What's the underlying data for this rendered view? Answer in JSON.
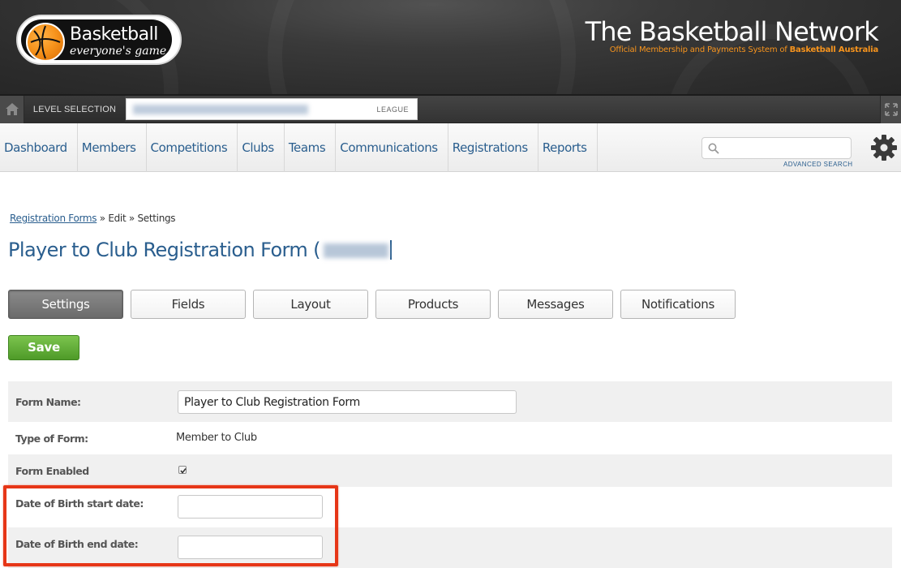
{
  "header": {
    "logo_name": "Basketball",
    "logo_tagline": "everyone's game",
    "brand_title": "The Basketball Network",
    "brand_subtitle_prefix": "Official Membership and Payments System of ",
    "brand_subtitle_bold": "Basketball Australia"
  },
  "levelbar": {
    "label": "LEVEL SELECTION",
    "level_type": "LEAGUE"
  },
  "nav": {
    "items": [
      "Dashboard",
      "Members",
      "Competitions",
      "Clubs",
      "Teams",
      "Communications",
      "Registrations",
      "Reports"
    ],
    "search_placeholder": "",
    "advanced_search": "ADVANCED SEARCH"
  },
  "breadcrumb": {
    "link": "Registration Forms",
    "rest": " » Edit » Settings"
  },
  "page_title": "Player to Club Registration Form (",
  "tabs": [
    "Settings",
    "Fields",
    "Layout",
    "Products",
    "Messages",
    "Notifications"
  ],
  "active_tab": "Settings",
  "save_label": "Save",
  "form": {
    "form_name_label": "Form Name:",
    "form_name_value": "Player to Club Registration Form",
    "type_label": "Type of Form:",
    "type_value": "Member to Club",
    "enabled_label": "Form Enabled",
    "enabled": true,
    "dob_start_label": "Date of Birth start date:",
    "dob_start_value": "",
    "dob_end_label": "Date of Birth end date:",
    "dob_end_value": ""
  },
  "colors": {
    "link_blue": "#2a5e8e",
    "save_green": "#5aa830",
    "highlight_red": "#e63617",
    "brand_orange": "#f7941d"
  }
}
